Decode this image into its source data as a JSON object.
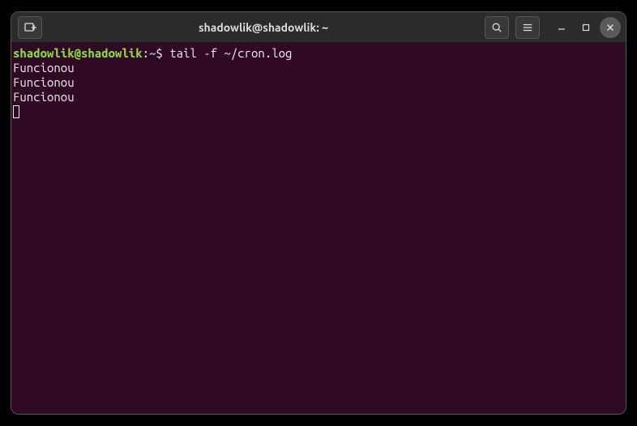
{
  "titlebar": {
    "title": "shadowlik@shadowlik: ~"
  },
  "prompt": {
    "user_host": "shadowlik@shadowlik",
    "colon": ":",
    "path": "~",
    "symbol": "$",
    "command": " tail -f ~/cron.log"
  },
  "output": [
    "Funcionou",
    "Funcionou",
    "Funcionou"
  ]
}
